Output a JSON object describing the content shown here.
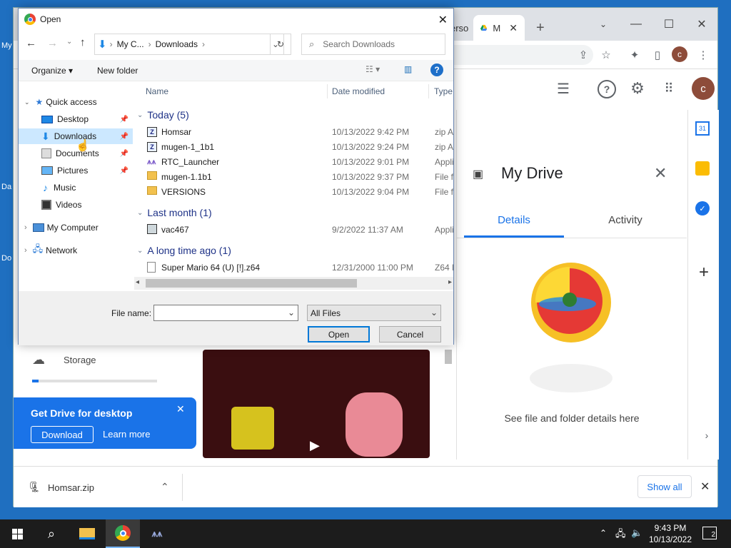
{
  "desktop": {
    "labels": [
      "My",
      "Da",
      "Do"
    ]
  },
  "chrome": {
    "tabs": [
      {
        "label": "erso"
      },
      {
        "label": "M"
      }
    ],
    "new_tab": "+",
    "avatar": "c",
    "drive_avatar": "c"
  },
  "drive": {
    "details_title": "My Drive",
    "tabs": {
      "details": "Details",
      "activity": "Activity"
    },
    "empty_text": "See file and folder details here",
    "storage_label": "Storage",
    "storage_fraction": 0.05,
    "promo": {
      "title": "Get Drive for desktop",
      "download": "Download",
      "learn_more": "Learn more"
    },
    "colors": {
      "accent": "#1a73e8"
    }
  },
  "download_bar": {
    "file": "Homsar.zip",
    "show_all": "Show all"
  },
  "dialog": {
    "title": "Open",
    "breadcrumb": [
      "My C...",
      "Downloads"
    ],
    "search_placeholder": "Search Downloads",
    "organize": "Organize",
    "new_folder": "New folder",
    "nav": {
      "quick_access": "Quick access",
      "items": [
        {
          "label": "Desktop",
          "icon": "desktop-icon",
          "pinned": true
        },
        {
          "label": "Downloads",
          "icon": "download-icon",
          "pinned": true,
          "selected": true
        },
        {
          "label": "Documents",
          "icon": "documents-icon",
          "pinned": true
        },
        {
          "label": "Pictures",
          "icon": "pictures-icon",
          "pinned": true
        },
        {
          "label": "Music",
          "icon": "music-icon"
        },
        {
          "label": "Videos",
          "icon": "videos-icon"
        }
      ],
      "my_computer": "My Computer",
      "network": "Network"
    },
    "columns": {
      "name": "Name",
      "date": "Date modified",
      "type": "Type"
    },
    "groups": [
      {
        "label": "Today (5)",
        "files": [
          {
            "name": "Homsar",
            "date": "10/13/2022 9:42 PM",
            "type": "zip A",
            "icon": "zip-icon"
          },
          {
            "name": "mugen-1_1b1",
            "date": "10/13/2022 9:24 PM",
            "type": "zip A",
            "icon": "zip-icon"
          },
          {
            "name": "RTC_Launcher",
            "date": "10/13/2022 9:01 PM",
            "type": "Appli",
            "icon": "app-icon"
          },
          {
            "name": "mugen-1.1b1",
            "date": "10/13/2022 9:37 PM",
            "type": "File fo",
            "icon": "folder-icon"
          },
          {
            "name": "VERSIONS",
            "date": "10/13/2022 9:04 PM",
            "type": "File fo",
            "icon": "folder-icon"
          }
        ]
      },
      {
        "label": "Last month (1)",
        "files": [
          {
            "name": "vac467",
            "date": "9/2/2022 11:37 AM",
            "type": "Appli",
            "icon": "exe-icon"
          }
        ]
      },
      {
        "label": "A long time ago (1)",
        "files": [
          {
            "name": "Super Mario 64 (U) [!].z64",
            "date": "12/31/2000 11:00 PM",
            "type": "Z64 F",
            "icon": "file-icon"
          }
        ]
      }
    ],
    "file_name_label": "File name:",
    "file_name_value": "",
    "filter": "All Files",
    "open": "Open",
    "cancel": "Cancel"
  },
  "taskbar": {
    "time": "9:43 PM",
    "date": "10/13/2022",
    "notifications": "2"
  }
}
